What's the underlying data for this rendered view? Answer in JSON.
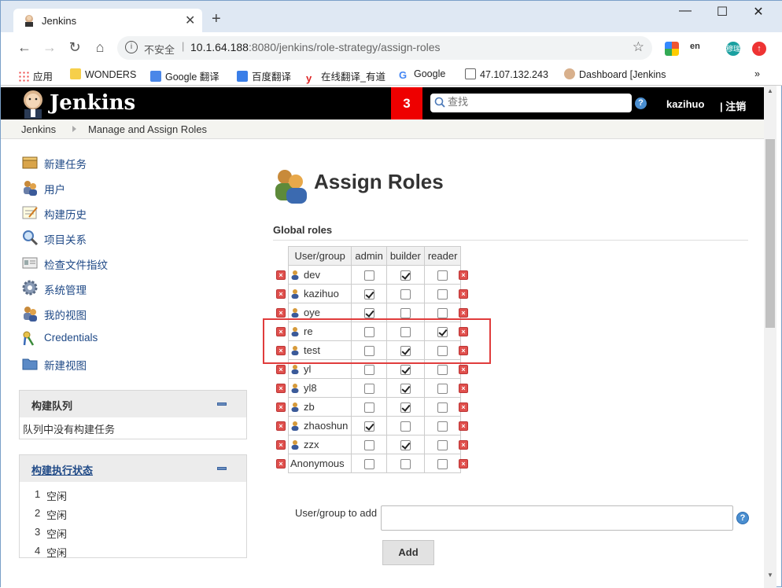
{
  "browser": {
    "tab_title": "Jenkins",
    "insecure_label": "不安全",
    "url_host": "10.1.64.188",
    "url_rest": ":8080/jenkins/role-strategy/assign-roles",
    "bookmarks": [
      "应用",
      "WONDERS",
      "Google 翻译",
      "百度翻译",
      "在线翻译_有道",
      "Google",
      "47.107.132.243",
      "Dashboard [Jenkins"
    ],
    "more": "»"
  },
  "header": {
    "logo_text": "Jenkins",
    "notification_count": "3",
    "search_placeholder": "查找",
    "search_help": "?",
    "user": "kazihuo",
    "logout": "| 注销"
  },
  "breadcrumb": [
    "Jenkins",
    "Manage and Assign Roles"
  ],
  "sidebar": {
    "items": [
      {
        "label": "新建任务",
        "icon": "new-item-icon"
      },
      {
        "label": "用户",
        "icon": "users-icon"
      },
      {
        "label": "构建历史",
        "icon": "build-history-icon"
      },
      {
        "label": "项目关系",
        "icon": "search-icon"
      },
      {
        "label": "检查文件指纹",
        "icon": "fingerprint-icon"
      },
      {
        "label": "系统管理",
        "icon": "gear-icon"
      },
      {
        "label": "我的视图",
        "icon": "users-icon"
      },
      {
        "label": "Credentials",
        "icon": "keys-icon"
      },
      {
        "label": "新建视图",
        "icon": "folder-icon"
      }
    ]
  },
  "build_queue": {
    "title": "构建队列",
    "empty_text": "队列中没有构建任务"
  },
  "executors": {
    "title": "构建执行状态",
    "rows": [
      {
        "num": "1",
        "state": "空闲"
      },
      {
        "num": "2",
        "state": "空闲"
      },
      {
        "num": "3",
        "state": "空闲"
      },
      {
        "num": "4",
        "state": "空闲"
      }
    ]
  },
  "main": {
    "title": "Assign Roles",
    "section": "Global roles",
    "columns": [
      "User/group",
      "admin",
      "builder",
      "reader"
    ],
    "rows": [
      {
        "name": "dev",
        "person": true,
        "admin": false,
        "builder": true,
        "reader": false
      },
      {
        "name": "kazihuo",
        "person": true,
        "admin": true,
        "builder": false,
        "reader": false
      },
      {
        "name": "oye",
        "person": true,
        "admin": true,
        "builder": false,
        "reader": false
      },
      {
        "name": "re",
        "person": true,
        "admin": false,
        "builder": false,
        "reader": true
      },
      {
        "name": "test",
        "person": true,
        "admin": false,
        "builder": true,
        "reader": false
      },
      {
        "name": "yl",
        "person": true,
        "admin": false,
        "builder": true,
        "reader": false
      },
      {
        "name": "yl8",
        "person": true,
        "admin": false,
        "builder": true,
        "reader": false
      },
      {
        "name": "zb",
        "person": true,
        "admin": false,
        "builder": true,
        "reader": false
      },
      {
        "name": "zhaoshun",
        "person": true,
        "admin": true,
        "builder": false,
        "reader": false
      },
      {
        "name": "zzx",
        "person": true,
        "admin": false,
        "builder": true,
        "reader": false
      },
      {
        "name": "Anonymous",
        "person": false,
        "admin": false,
        "builder": false,
        "reader": false
      }
    ],
    "add_label": "User/group to add",
    "add_value": "",
    "add_button": "Add",
    "help": "?"
  }
}
